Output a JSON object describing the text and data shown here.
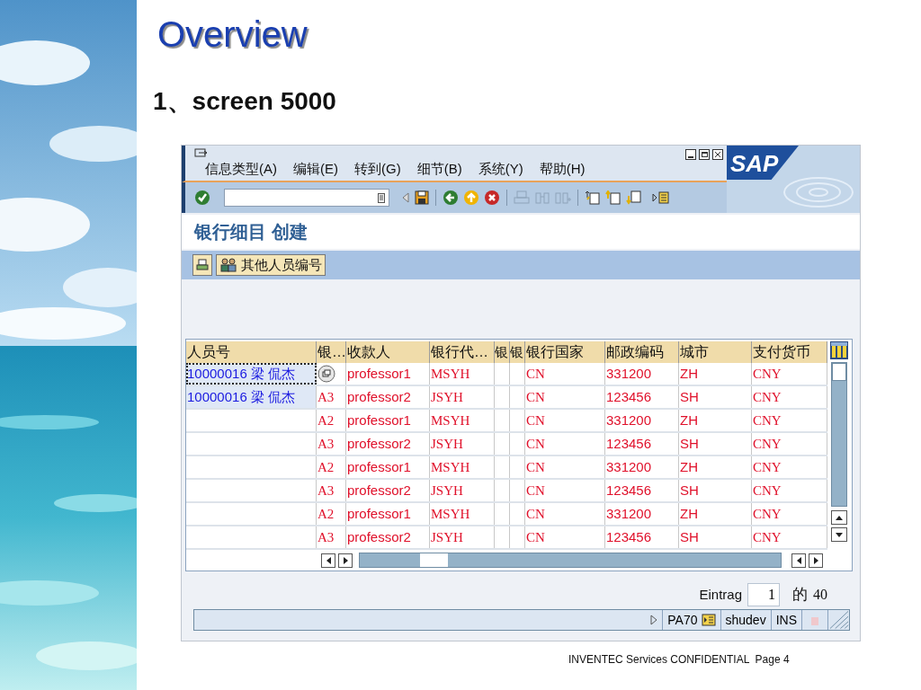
{
  "slide": {
    "title": "Overview",
    "subtitle": "1、screen 5000",
    "footer": "INVENTEC Services CONFIDENTIAL  Page 4"
  },
  "sap": {
    "menu": [
      "信息类型(A)",
      "编辑(E)",
      "转到(G)",
      "细节(B)",
      "系统(Y)",
      "帮助(H)"
    ],
    "logo": "SAP",
    "screen_title": "银行细目 创建",
    "other_personnel_button": "其他人员编号",
    "table": {
      "columns": [
        "人员号",
        "银…",
        "收款人",
        "银行代…",
        "银",
        "银",
        "银行国家",
        "邮政编码",
        "城市",
        "支付货币"
      ],
      "rows": [
        {
          "personnel": "10000016 梁 侃杰",
          "value_help": true,
          "focused": true,
          "payee": "professor1",
          "bank_key": "MSYH",
          "country": "CN",
          "postal_code": "331200",
          "city": "ZH",
          "currency": "CNY"
        },
        {
          "personnel": "10000016 梁 侃杰",
          "value_help": false,
          "focused": false,
          "bank_type": "A3",
          "payee": "professor2",
          "bank_key": "JSYH",
          "country": "CN",
          "postal_code": "123456",
          "city": "SH",
          "currency": "CNY"
        },
        {
          "value_help": false,
          "focused": false,
          "bank_type": "A2",
          "payee": "professor1",
          "bank_key": "MSYH",
          "country": "CN",
          "postal_code": "331200",
          "city": "ZH",
          "currency": "CNY"
        },
        {
          "value_help": false,
          "focused": false,
          "bank_type": "A3",
          "payee": "professor2",
          "bank_key": "JSYH",
          "country": "CN",
          "postal_code": "123456",
          "city": "SH",
          "currency": "CNY"
        },
        {
          "value_help": false,
          "focused": false,
          "bank_type": "A2",
          "payee": "professor1",
          "bank_key": "MSYH",
          "country": "CN",
          "postal_code": "331200",
          "city": "ZH",
          "currency": "CNY"
        },
        {
          "value_help": false,
          "focused": false,
          "bank_type": "A3",
          "payee": "professor2",
          "bank_key": "JSYH",
          "country": "CN",
          "postal_code": "123456",
          "city": "SH",
          "currency": "CNY"
        },
        {
          "value_help": false,
          "focused": false,
          "bank_type": "A2",
          "payee": "professor1",
          "bank_key": "MSYH",
          "country": "CN",
          "postal_code": "331200",
          "city": "ZH",
          "currency": "CNY"
        },
        {
          "value_help": false,
          "focused": false,
          "bank_type": "A3",
          "payee": "professor2",
          "bank_key": "JSYH",
          "country": "CN",
          "postal_code": "123456",
          "city": "SH",
          "currency": "CNY"
        }
      ]
    },
    "entry": {
      "label": "Eintrag",
      "value": "1",
      "of": "的",
      "total": "40"
    },
    "status_bar": {
      "transaction": "PA70",
      "system": "shudev",
      "mode": "INS"
    }
  }
}
